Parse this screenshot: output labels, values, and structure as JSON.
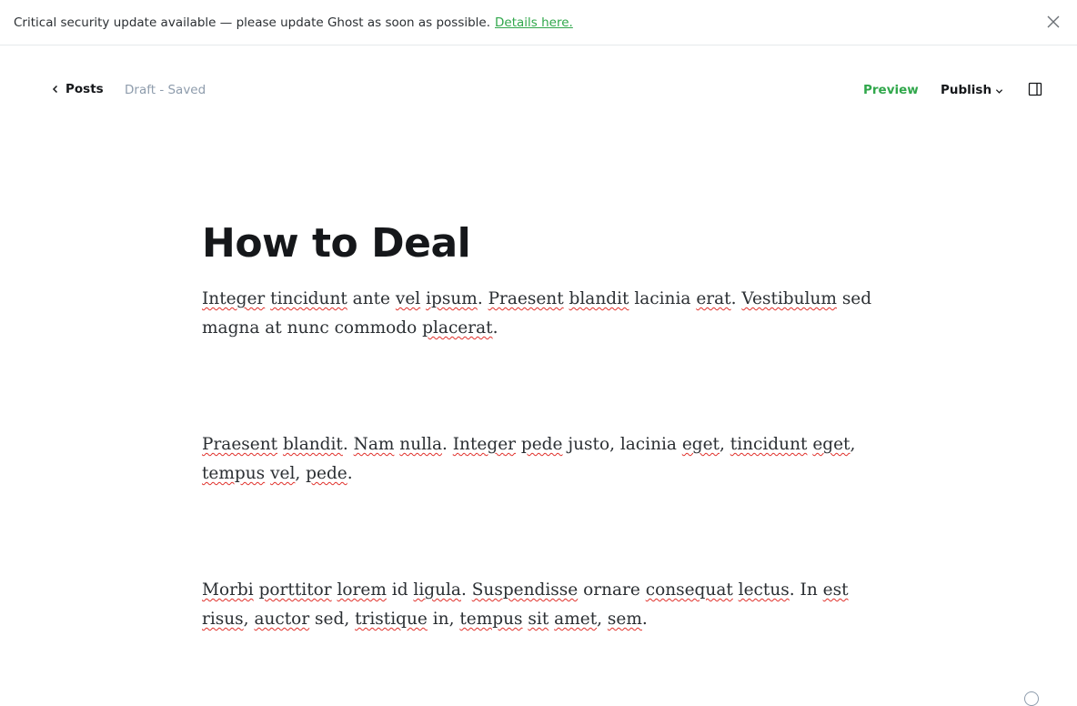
{
  "alert": {
    "message": "Critical security update available — please update Ghost as soon as possible.",
    "link_text": "Details here."
  },
  "header": {
    "back_label": "Posts",
    "status": "Draft - Saved",
    "preview_label": "Preview",
    "publish_label": "Publish"
  },
  "post": {
    "title": "How to Deal",
    "paragraphs": [
      [
        {
          "t": "Integer",
          "s": true
        },
        {
          "t": " "
        },
        {
          "t": "tincidunt",
          "s": true
        },
        {
          "t": " ante "
        },
        {
          "t": "vel",
          "s": true
        },
        {
          "t": " "
        },
        {
          "t": "ipsum",
          "s": true
        },
        {
          "t": ". "
        },
        {
          "t": "Praesent",
          "s": true
        },
        {
          "t": " "
        },
        {
          "t": "blandit",
          "s": true
        },
        {
          "t": " lacinia "
        },
        {
          "t": "erat",
          "s": true
        },
        {
          "t": ". "
        },
        {
          "t": "Vestibulum",
          "s": true
        },
        {
          "t": " sed magna at nunc commodo "
        },
        {
          "t": "placerat",
          "s": true
        },
        {
          "t": "."
        }
      ],
      [
        {
          "t": "Praesent",
          "s": true
        },
        {
          "t": " "
        },
        {
          "t": "blandit",
          "s": true
        },
        {
          "t": ". "
        },
        {
          "t": "Nam",
          "s": true
        },
        {
          "t": " "
        },
        {
          "t": "nulla",
          "s": true
        },
        {
          "t": ". "
        },
        {
          "t": "Integer",
          "s": true
        },
        {
          "t": " "
        },
        {
          "t": "pede",
          "s": true
        },
        {
          "t": " justo, lacinia "
        },
        {
          "t": "eget",
          "s": true
        },
        {
          "t": ", "
        },
        {
          "t": "tincidunt",
          "s": true
        },
        {
          "t": " "
        },
        {
          "t": "eget",
          "s": true
        },
        {
          "t": ", "
        },
        {
          "t": "tempus",
          "s": true
        },
        {
          "t": " "
        },
        {
          "t": "vel",
          "s": true
        },
        {
          "t": ", "
        },
        {
          "t": "pede",
          "s": true
        },
        {
          "t": "."
        }
      ],
      [
        {
          "t": "Morbi",
          "s": true
        },
        {
          "t": " "
        },
        {
          "t": "porttitor",
          "s": true
        },
        {
          "t": " "
        },
        {
          "t": "lorem",
          "s": true
        },
        {
          "t": " id "
        },
        {
          "t": "ligula",
          "s": true
        },
        {
          "t": ". "
        },
        {
          "t": "Suspendisse",
          "s": true
        },
        {
          "t": " ornare "
        },
        {
          "t": "consequat",
          "s": true
        },
        {
          "t": " "
        },
        {
          "t": "lectus",
          "s": true
        },
        {
          "t": ". In "
        },
        {
          "t": "est",
          "s": true
        },
        {
          "t": " "
        },
        {
          "t": "risus",
          "s": true
        },
        {
          "t": ", "
        },
        {
          "t": "auctor",
          "s": true
        },
        {
          "t": " sed, "
        },
        {
          "t": "tristique",
          "s": true
        },
        {
          "t": " in, "
        },
        {
          "t": "tempus",
          "s": true
        },
        {
          "t": " "
        },
        {
          "t": "sit",
          "s": true
        },
        {
          "t": " "
        },
        {
          "t": "amet",
          "s": true
        },
        {
          "t": ", "
        },
        {
          "t": "sem",
          "s": true
        },
        {
          "t": "."
        }
      ]
    ]
  },
  "colors": {
    "accent_green": "#30a74b",
    "muted_text": "#8e9cac",
    "spellcheck": "#e0302a"
  }
}
